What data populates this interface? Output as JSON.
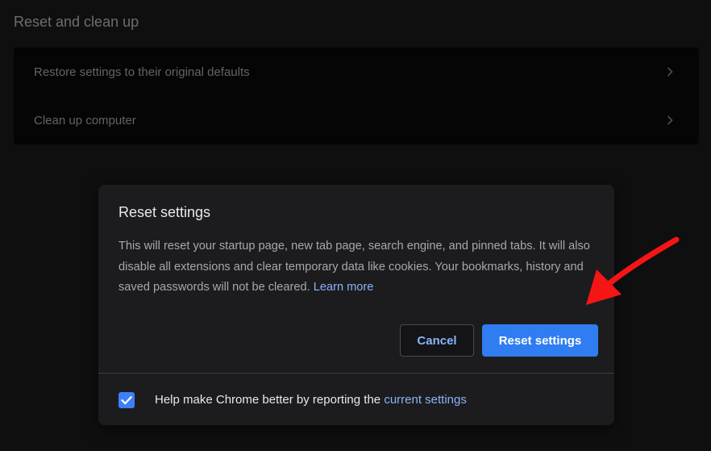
{
  "section": {
    "title": "Reset and clean up",
    "rows": [
      {
        "label": "Restore settings to their original defaults"
      },
      {
        "label": "Clean up computer"
      }
    ]
  },
  "dialog": {
    "title": "Reset settings",
    "body": "This will reset your startup page, new tab page, search engine, and pinned tabs. It will also disable all extensions and clear temporary data like cookies. Your bookmarks, history and saved passwords will not be cleared.",
    "learn_more": "Learn more",
    "cancel_label": "Cancel",
    "reset_label": "Reset settings",
    "checkbox": {
      "checked": true,
      "label_prefix": "Help make Chrome better by reporting the",
      "label_link": "current settings"
    }
  },
  "colors": {
    "accent": "#2f7df0",
    "link": "#8ab4f8",
    "annotation_arrow": "#f51515"
  },
  "icons": {
    "row_chevron": "chevron-right-icon",
    "checkbox_mark": "checkmark-icon",
    "annotation": "red-arrow-icon"
  }
}
